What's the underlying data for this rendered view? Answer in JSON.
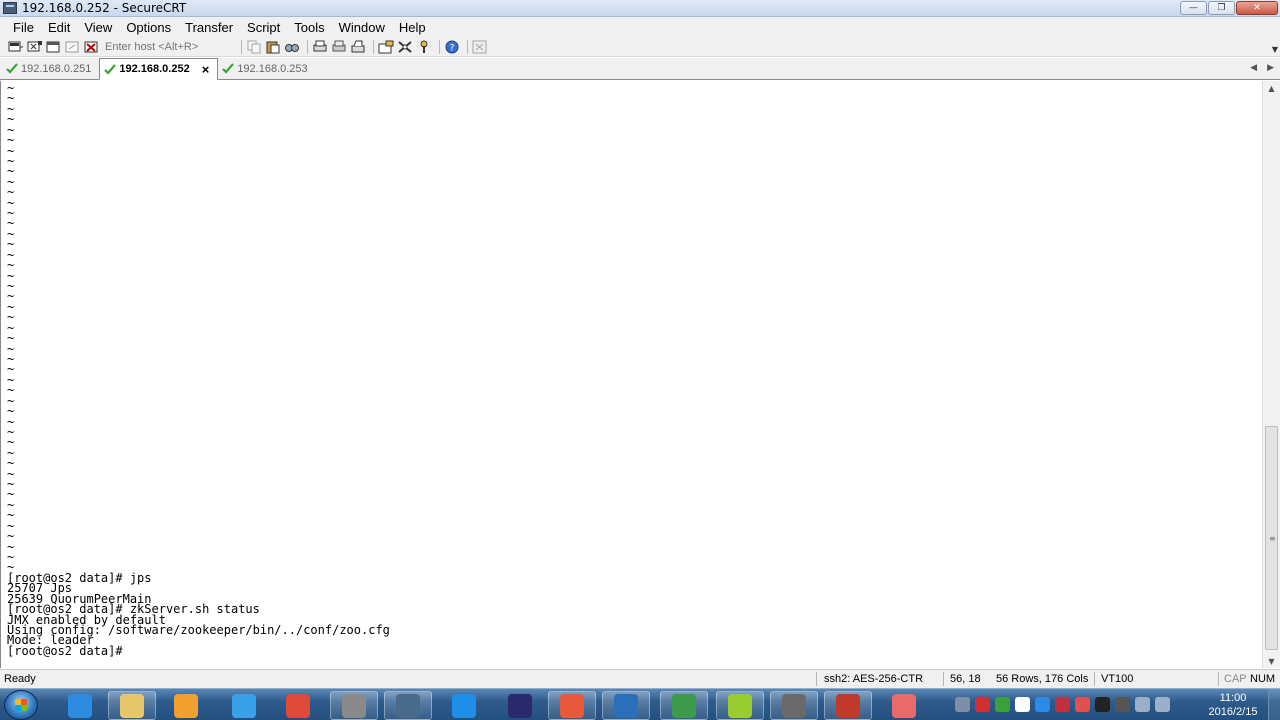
{
  "window": {
    "title": "192.168.0.252 - SecureCRT",
    "minimize_label": "—",
    "maximize_label": "❐",
    "close_label": "✕"
  },
  "menu": [
    "File",
    "Edit",
    "View",
    "Options",
    "Transfer",
    "Script",
    "Tools",
    "Window",
    "Help"
  ],
  "toolbar": {
    "host_placeholder": "Enter host <Alt+R>"
  },
  "tabs": [
    {
      "label": "192.168.0.251",
      "active": false
    },
    {
      "label": "192.168.0.252",
      "active": true,
      "close": "×"
    },
    {
      "label": "192.168.0.253",
      "active": false
    }
  ],
  "tab_nav": {
    "left": "◀",
    "right": "▶"
  },
  "terminal": {
    "tilde_count": 47,
    "tilde_char": "~",
    "lines": [
      "[root@os2 data]# jps",
      "25707 Jps",
      "25639 QuorumPeerMain",
      "[root@os2 data]# zkServer.sh status",
      "JMX enabled by default",
      "Using config: /software/zookeeper/bin/../conf/zoo.cfg",
      "Mode: leader",
      "[root@os2 data]#"
    ],
    "scroll_position": 0.92
  },
  "statusbar": {
    "ready": "Ready",
    "cipher": "ssh2: AES-256-CTR",
    "cursor": "56,  18",
    "size": "56 Rows, 176 Cols",
    "emulation": "VT100",
    "cap": "CAP",
    "num": "NUM"
  },
  "taskbar": {
    "apps": [
      {
        "name": "internet-explorer",
        "color": "#2d8be0",
        "running": false
      },
      {
        "name": "file-explorer",
        "color": "#e8c66a",
        "running": true
      },
      {
        "name": "media-player",
        "color": "#f0a030",
        "running": false
      },
      {
        "name": "cloud-drive",
        "color": "#3aa0e8",
        "running": false
      },
      {
        "name": "chrome",
        "color": "#e04a3a",
        "running": false
      },
      {
        "name": "securefx",
        "color": "#8a8a8a",
        "running": true
      },
      {
        "name": "vpn-client",
        "color": "#4a6a8a",
        "running": true
      },
      {
        "name": "note-app",
        "color": "#1e8fe6",
        "running": false
      },
      {
        "name": "eclipse",
        "color": "#2c2a6e",
        "running": false
      },
      {
        "name": "tool-app",
        "color": "#e8583a",
        "running": true
      },
      {
        "name": "virtualbox",
        "color": "#2b6fb8",
        "running": true
      },
      {
        "name": "editor-p",
        "color": "#3c9a4a",
        "running": true
      },
      {
        "name": "mindmap-m",
        "color": "#9acd32",
        "running": true
      },
      {
        "name": "securecrt",
        "color": "#6a6a6a",
        "running": true
      },
      {
        "name": "pdf-reader",
        "color": "#c0392b",
        "running": true
      },
      {
        "name": "eraser-app",
        "color": "#e86a6a",
        "running": false
      }
    ],
    "clock_time": "11:00",
    "clock_date": "2016/2/15"
  }
}
